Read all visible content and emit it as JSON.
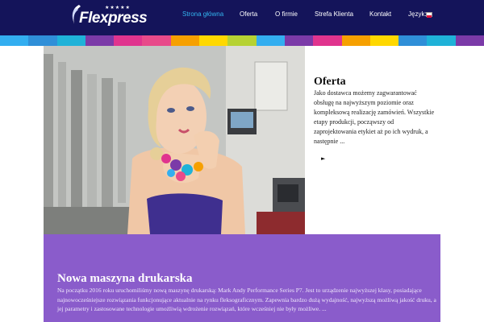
{
  "brand": {
    "logo_text": "Flexpress",
    "stars": "★★★★★"
  },
  "nav": {
    "items": [
      {
        "label": "Strona główna",
        "active": true
      },
      {
        "label": "Oferta",
        "active": false
      },
      {
        "label": "O firmie",
        "active": false
      },
      {
        "label": "Strefa Klienta",
        "active": false
      },
      {
        "label": "Kontakt",
        "active": false
      },
      {
        "label": "Język:",
        "active": false
      }
    ],
    "language_flag": "polish-flag-icon"
  },
  "stripe_colors": [
    "#33aef0",
    "#2f8fd8",
    "#1fb2d8",
    "#7b3aa8",
    "#e0348e",
    "#e84a8a",
    "#f6a000",
    "#ffd800",
    "#b6d233",
    "#33aef0",
    "#7b3aa8",
    "#e0348e",
    "#f6a000",
    "#ffd800",
    "#2f8fd8",
    "#1fb2d8",
    "#7b3aa8"
  ],
  "hero": {
    "title": "Oferta",
    "description": "Jako dostawca możemy zagwarantować obsługę na najwyższym poziomie oraz kompleksową realizację zamówień. Wszystkie etapy produkcji, począwszy od zaprojektowania etykiet aż po ich wydruk, a następnie ...",
    "arrow": "►"
  },
  "news": {
    "title": "Nowa maszyna drukarska",
    "text": "Na początku 2016 roku uruchomiliśmy nową maszynę drukarską: Mark Andy Performance Series P7. Jest to urządzenie najwyższej klasy, posiadające najnowocześniejsze rozwiązania funkcjonujące aktualnie na rynku fleksograficznym. Zapewnia bardzo dużą wydajność, najwyższą możliwą jakość druku, a jej parametry i zastosowane technologie umożliwią wdrożenie rozwiązań, które wcześniej nie były możliwe. ..."
  }
}
